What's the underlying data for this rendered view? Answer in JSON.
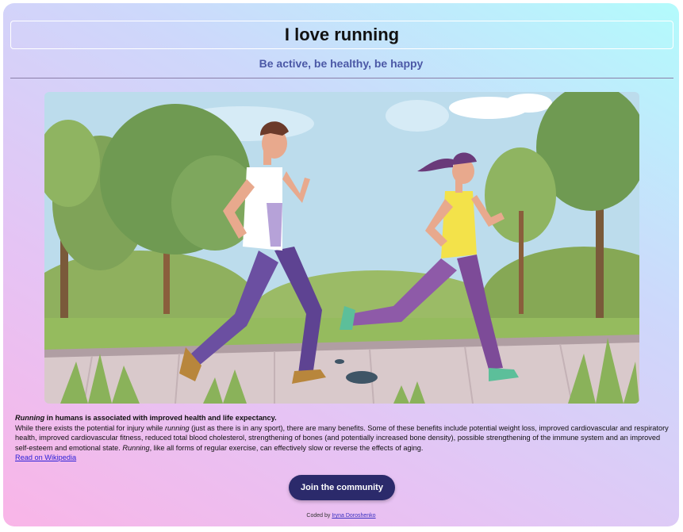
{
  "header": {
    "title": "I love running",
    "subtitle": "Be active, be healthy, be happy"
  },
  "hero": {
    "alt": "Illustration of a man and a woman jogging in a park"
  },
  "article": {
    "lead_emphasis": "Running",
    "lead_rest": " in humans is associated with improved health and life expectancy.",
    "p1": "While there exists the potential for injury while ",
    "p1_emphasis": "running",
    "p2": " (just as there is in any sport), there are many benefits. Some of these benefits include potential weight loss, improved cardiovascular and respiratory health, improved cardiovascular fitness, reduced total blood cholesterol, strengthening of bones (and potentially increased bone density), possible strengthening of the immune system and an improved self-esteem and emotional state. ",
    "p2_emphasis": "Running",
    "p3": ", like all forms of regular exercise, can effectively slow or reverse the effects of aging.",
    "link_label": "Read on Wikipedia"
  },
  "cta": {
    "label": "Join the community"
  },
  "footer": {
    "prefix": "Coded by ",
    "author": "Iryna Doroshenko"
  },
  "colors": {
    "accent": "#2b2a6b",
    "subtitle": "#4b58a6",
    "link": "#2a1fd6"
  }
}
